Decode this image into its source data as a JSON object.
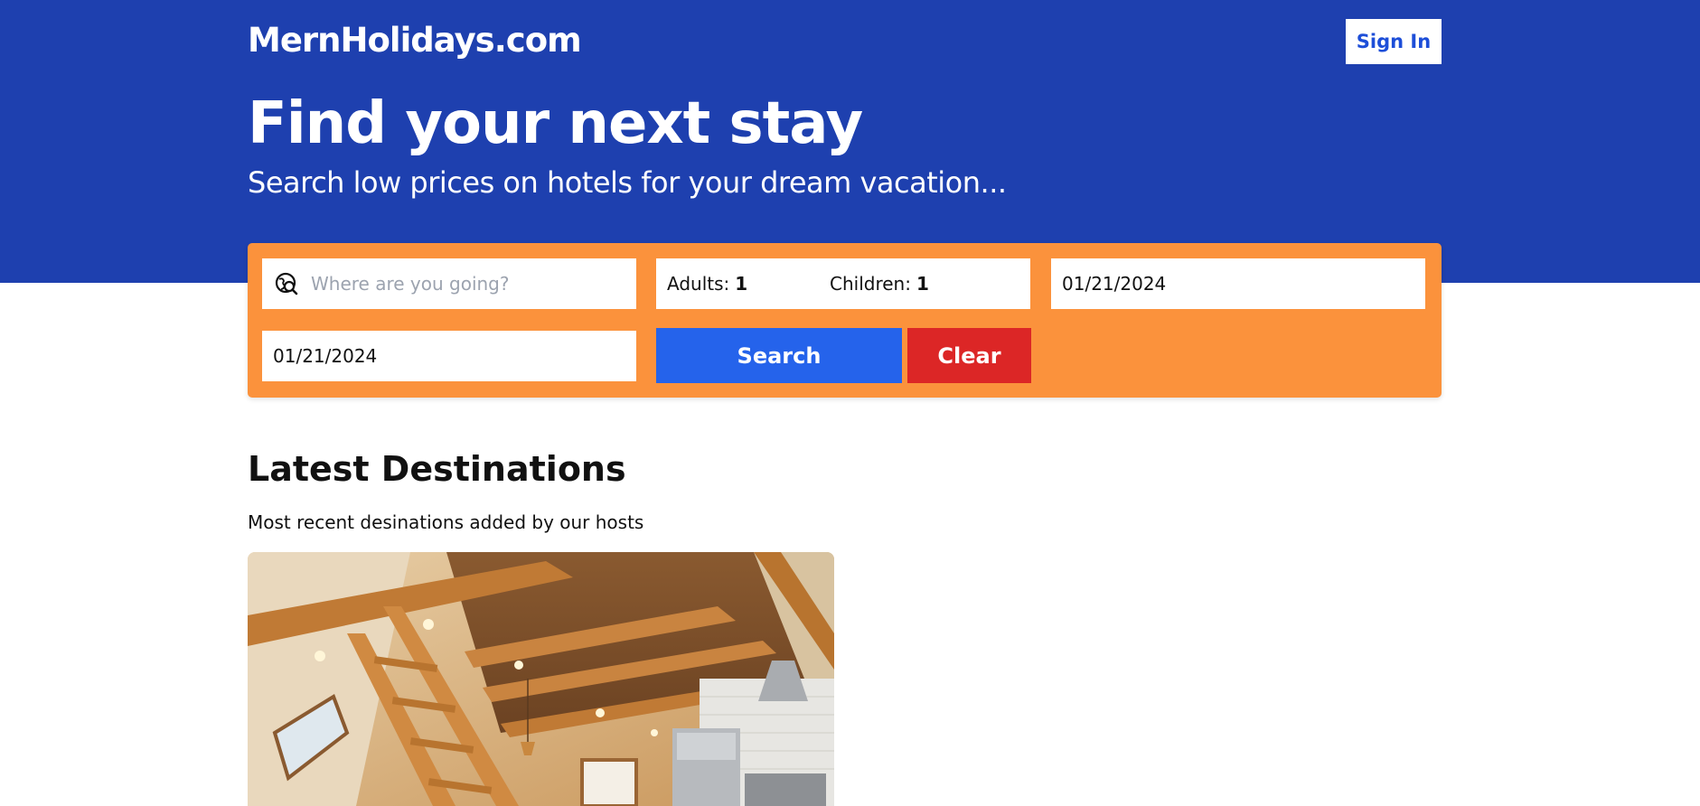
{
  "header": {
    "logo": "MernHolidays.com",
    "sign_in_label": "Sign In",
    "title": "Find your next stay",
    "subtitle": "Search low prices on hotels for your dream vacation..."
  },
  "search": {
    "destination_placeholder": "Where are you going?",
    "destination_icon": "globe-search-icon",
    "adults_label": "Adults:",
    "adults_value": "1",
    "children_label": "Children:",
    "children_value": "1",
    "check_in": "01/21/2024",
    "check_out": "01/21/2024",
    "search_label": "Search",
    "clear_label": "Clear"
  },
  "latest": {
    "title": "Latest Destinations",
    "subtitle": "Most recent desinations added by our hosts"
  },
  "colors": {
    "brand_blue": "#1e40af",
    "search_bar_orange": "#fb923c",
    "search_button": "#2563eb",
    "clear_button": "#dc2626",
    "sign_in_text": "#1d4ed8"
  }
}
